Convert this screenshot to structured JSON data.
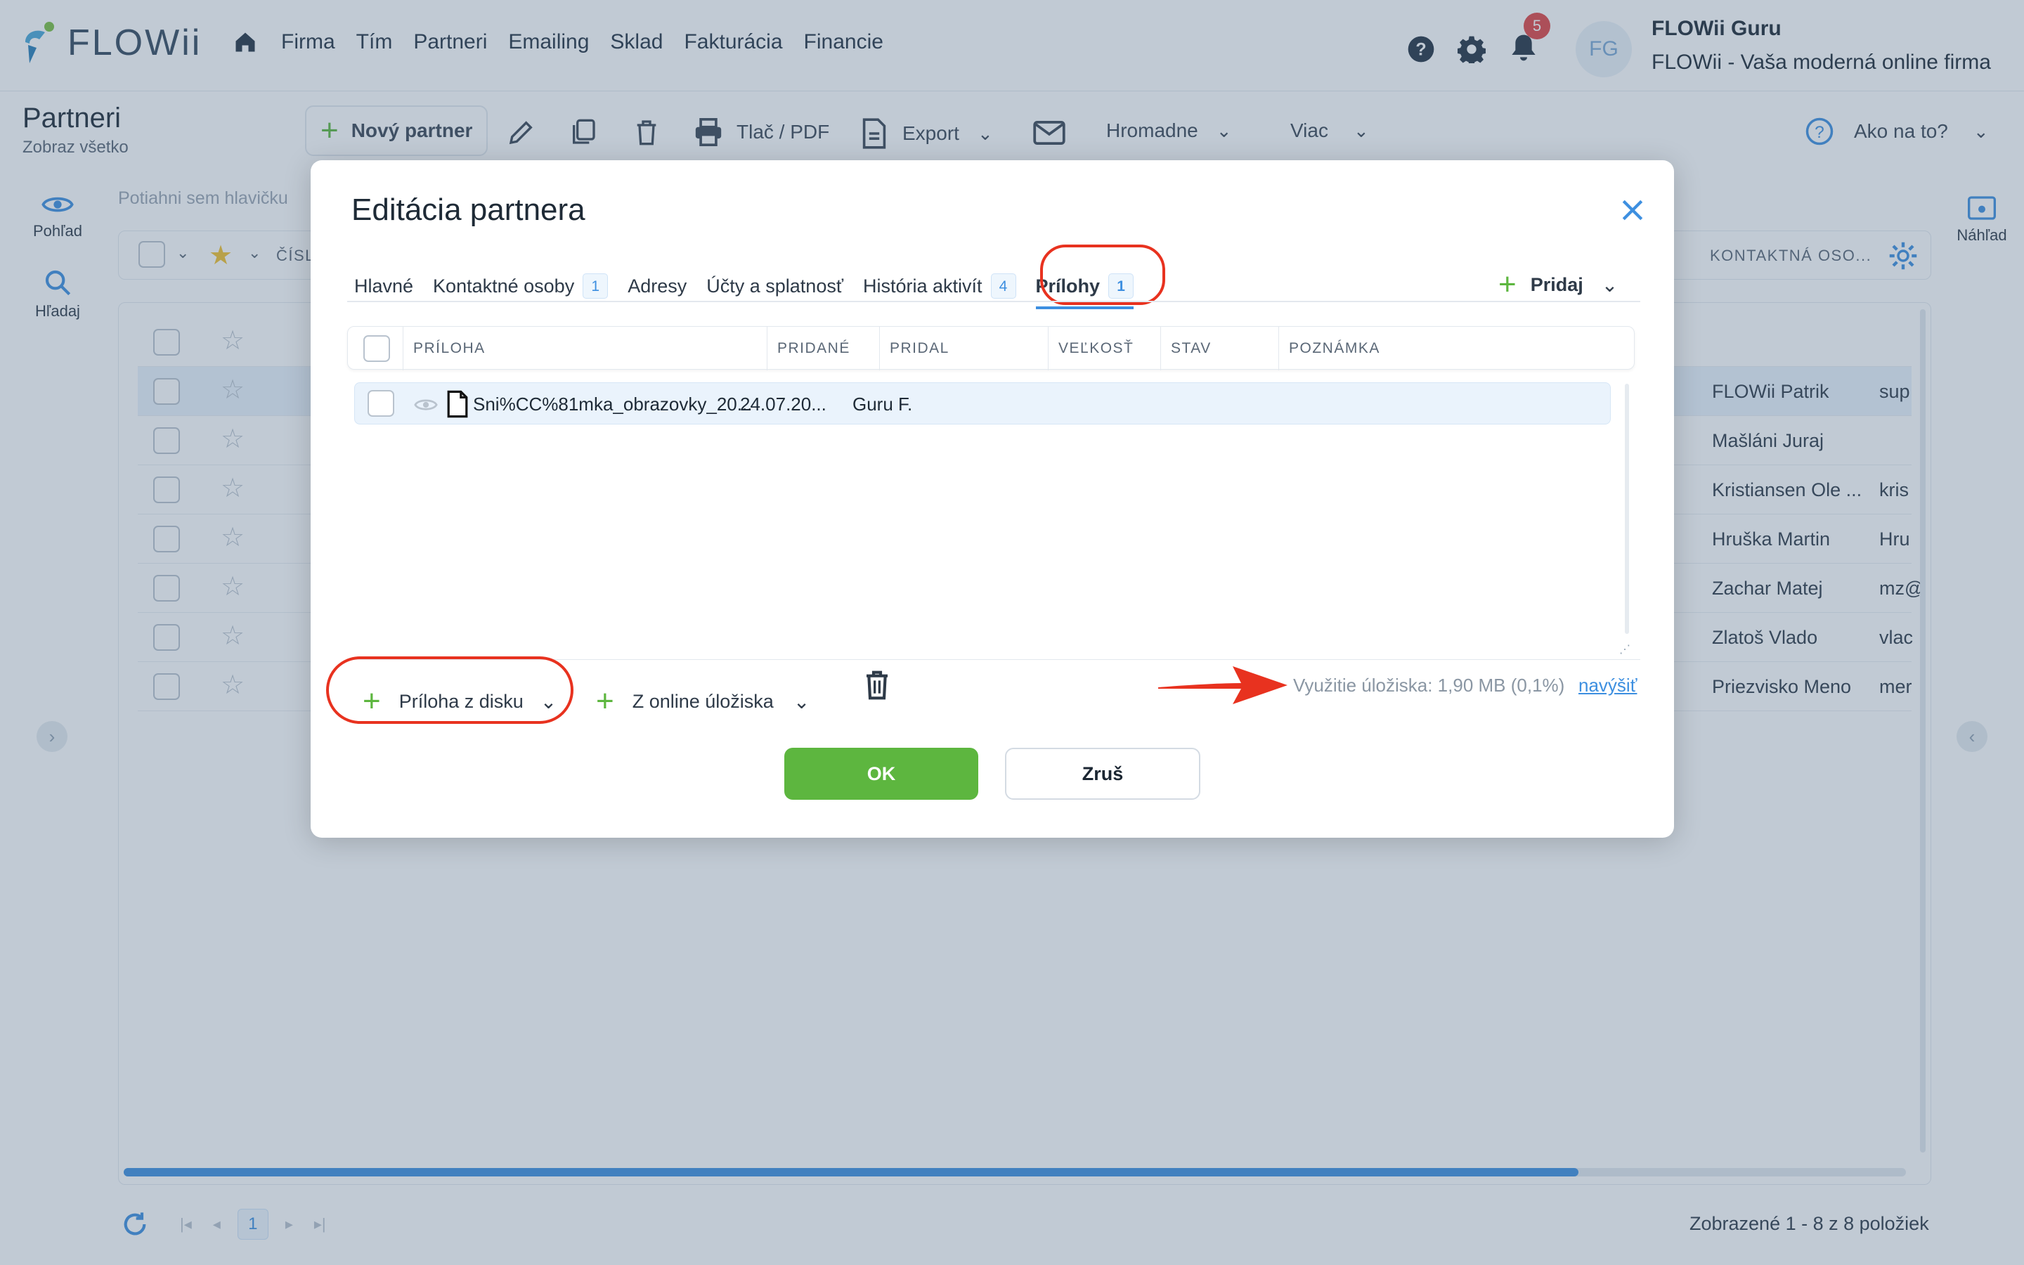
{
  "brand": {
    "name": "FLOWii"
  },
  "nav": [
    "Firma",
    "Tím",
    "Partneri",
    "Emailing",
    "Sklad",
    "Fakturácia",
    "Financie"
  ],
  "user": {
    "initials": "FG",
    "name": "FLOWii Guru",
    "company": "FLOWii - Vaša moderná online firma",
    "notifications": "5"
  },
  "page": {
    "title": "Partneri",
    "subtitle": "Zobraz všetko"
  },
  "toolbar": {
    "new_partner": "Nový partner",
    "print": "Tlač / PDF",
    "export": "Export",
    "bulk": "Hromadne",
    "more": "Viac",
    "howto": "Ako na to?"
  },
  "side": {
    "view": "Pohľad",
    "search": "Hľadaj",
    "preview": "Náhľad"
  },
  "grid": {
    "drag_hint": "Potiahni sem hlavičku",
    "col_number": "ČÍSL",
    "col_contact": "KONTAKTNÁ OSO...",
    "rows": [
      {
        "name": "FLOWii Patrik",
        "extra": "sup"
      },
      {
        "name": "Mašláni Juraj",
        "extra": ""
      },
      {
        "name": "Kristiansen Ole ...",
        "extra": "kris"
      },
      {
        "name": "Hruška Martin",
        "extra": "Hru"
      },
      {
        "name": "Zachar Matej",
        "extra": "mz@"
      },
      {
        "name": "Zlatoš Vlado",
        "extra": "vlac"
      },
      {
        "name": "Priezvisko Meno",
        "extra": "mer"
      }
    ],
    "page": "1",
    "summary": "Zobrazené 1 - 8 z 8 položiek"
  },
  "modal": {
    "title": "Editácia partnera",
    "tabs": [
      {
        "label": "Hlavné",
        "count": ""
      },
      {
        "label": "Kontaktné osoby",
        "count": "1"
      },
      {
        "label": "Adresy",
        "count": ""
      },
      {
        "label": "Účty a splatnosť",
        "count": ""
      },
      {
        "label": "História aktivít",
        "count": "4"
      },
      {
        "label": "Prílohy",
        "count": "1"
      }
    ],
    "add": "Pridaj",
    "columns": [
      "PRÍLOHA",
      "PRIDANÉ",
      "PRIDAL",
      "VEĽKOSŤ",
      "STAV",
      "POZNÁMKA"
    ],
    "attachments": [
      {
        "file": "Sni%CC%81mka_obrazovky_20...",
        "added": "24.07.20...",
        "by": "Guru F.",
        "size": "",
        "state": "",
        "note": ""
      }
    ],
    "from_disk": "Príloha z disku",
    "from_online": "Z online úložiska",
    "storage_label": "Využitie úložiska: 1,90 MB (0,1%)",
    "increase": "navýšiť",
    "ok": "OK",
    "cancel": "Zruš"
  },
  "colors": {
    "accent": "#3d8fe0",
    "green": "#5db63f",
    "annotation": "#e8321f"
  }
}
